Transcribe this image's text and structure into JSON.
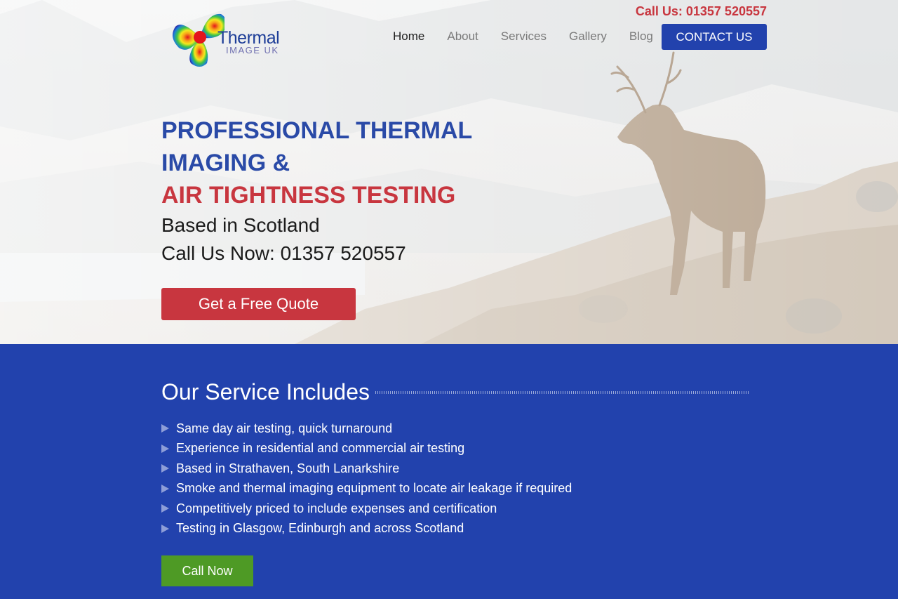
{
  "brand": {
    "logo_word": "Thermal",
    "logo_sub": "IMAGE UK",
    "colors": {
      "blue": "#2242ad",
      "red": "#c8363f",
      "green": "#4e9a25"
    }
  },
  "header": {
    "phone_text": "Call Us: 01357 520557",
    "nav": [
      {
        "label": "Home",
        "active": true
      },
      {
        "label": "About"
      },
      {
        "label": "Services"
      },
      {
        "label": "Gallery"
      },
      {
        "label": "Blog"
      }
    ],
    "contact_label": "CONTACT US"
  },
  "hero": {
    "line1": "PROFESSIONAL THERMAL",
    "line2": "IMAGING &",
    "line3": "AIR TIGHTNESS TESTING",
    "sub1": "Based in Scotland",
    "sub2": "Call Us Now: 01357 520557",
    "quote_label": "Get a Free Quote",
    "background": "deer-on-mountain-image"
  },
  "services": {
    "title": "Our Service Includes",
    "items": [
      "Same day air testing, quick turnaround",
      "Experience in residential and commercial air testing",
      "Based in Strathaven, South Lanarkshire",
      "Smoke and thermal imaging equipment to locate air leakage if required",
      "Competitively priced to include expenses and certification",
      "Testing in Glasgow, Edinburgh and across Scotland"
    ],
    "call_label": "Call Now"
  }
}
